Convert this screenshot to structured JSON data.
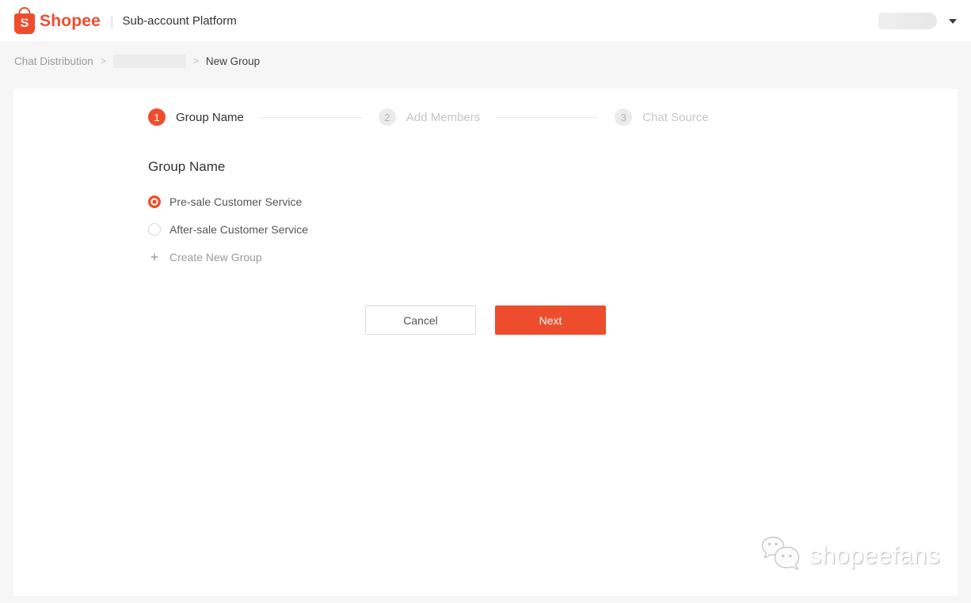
{
  "header": {
    "logo_letter": "S",
    "brand": "Shopee",
    "divider": "|",
    "product": "Sub-account Platform"
  },
  "breadcrumb": {
    "separator": ">",
    "items": [
      {
        "label": "Chat Distribution"
      },
      {
        "label": ""
      },
      {
        "label": "New Group"
      }
    ]
  },
  "steps": {
    "items": [
      {
        "number": "1",
        "label": "Group Name",
        "active": true
      },
      {
        "number": "2",
        "label": "Add Members",
        "active": false
      },
      {
        "number": "3",
        "label": "Chat Source",
        "active": false
      }
    ]
  },
  "form": {
    "title": "Group Name",
    "options": [
      {
        "label": "Pre-sale Customer Service",
        "selected": true
      },
      {
        "label": "After-sale Customer Service",
        "selected": false
      }
    ],
    "create_new": {
      "icon": "+",
      "label": "Create New Group"
    }
  },
  "actions": {
    "cancel_label": "Cancel",
    "next_label": "Next"
  },
  "watermark": {
    "text": "shopeefans"
  },
  "colors": {
    "brand_orange": "#ee4d2d",
    "page_bg": "#f6f6f7",
    "inactive_step": "#ebebeb"
  }
}
